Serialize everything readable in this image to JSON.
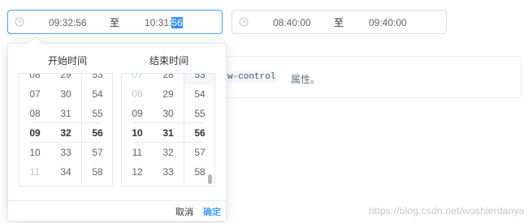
{
  "range1": {
    "start": "09:32:56",
    "separator": "至",
    "end_prefix": "10:31:",
    "end_selected": "56"
  },
  "range2": {
    "start": "08:40:00",
    "separator": "至",
    "end": "09:40:00"
  },
  "background": {
    "code": "w-control",
    "text": "属性。"
  },
  "picker": {
    "start_title": "开始时间",
    "end_title": "结束时间",
    "start_columns": [
      [
        "08",
        "07",
        "08",
        "09",
        "10",
        "11"
      ],
      [
        "29",
        "30",
        "31",
        "32",
        "33",
        "34"
      ],
      [
        "53",
        "54",
        "55",
        "56",
        "57",
        "58"
      ]
    ],
    "end_columns": [
      [
        "07",
        "08",
        "09",
        "10",
        "11",
        "12"
      ],
      [
        "28",
        "29",
        "30",
        "31",
        "32",
        "33"
      ],
      [
        "53",
        "54",
        "55",
        "56",
        "57",
        "58"
      ]
    ],
    "cancel_label": "取消",
    "confirm_label": "确定"
  },
  "watermark": "https://blog.csdn.net/woshierdanya",
  "colors": {
    "accent": "#409eff",
    "selection": "#3390ff",
    "border": "#dcdfe6"
  }
}
